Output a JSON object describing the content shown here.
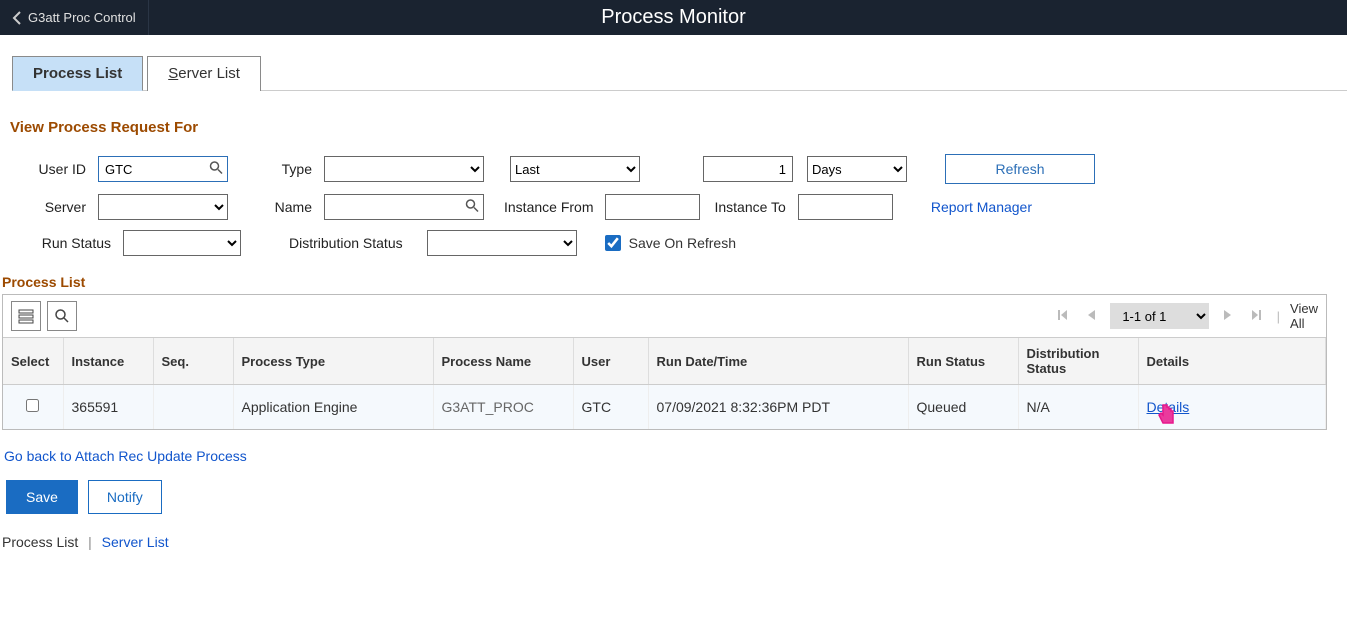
{
  "header": {
    "back_label": "G3att Proc Control",
    "title": "Process Monitor"
  },
  "tabs": {
    "process_list": "Process List",
    "server_list": "Server List"
  },
  "filter": {
    "section_title": "View Process Request For",
    "user_id_label": "User ID",
    "user_id_value": "GTC",
    "type_label": "Type",
    "last_label": "Last",
    "last_value": "1",
    "last_unit": "Days",
    "refresh_label": "Refresh",
    "server_label": "Server",
    "name_label": "Name",
    "instance_from_label": "Instance From",
    "instance_to_label": "Instance To",
    "report_manager_label": "Report Manager",
    "run_status_label": "Run Status",
    "dist_status_label": "Distribution Status",
    "save_on_refresh_label": "Save On Refresh"
  },
  "grid": {
    "section_title": "Process List",
    "range": "1-1 of 1",
    "view_all": "View All",
    "columns": {
      "select": "Select",
      "instance": "Instance",
      "seq": "Seq.",
      "process_type": "Process Type",
      "process_name": "Process Name",
      "user": "User",
      "run_dt": "Run Date/Time",
      "run_status": "Run Status",
      "dist_status": "Distribution Status",
      "details": "Details"
    },
    "row": {
      "instance": "365591",
      "seq": "",
      "process_type": "Application Engine",
      "process_name": "G3ATT_PROC",
      "user": "GTC",
      "run_dt": "07/09/2021  8:32:36PM PDT",
      "run_status": "Queued",
      "dist_status": "N/A",
      "details": "Details"
    }
  },
  "footer": {
    "back_link": "Go back to Attach Rec Update Process",
    "save": "Save",
    "notify": "Notify",
    "process_list": "Process List",
    "server_list": "Server List"
  }
}
